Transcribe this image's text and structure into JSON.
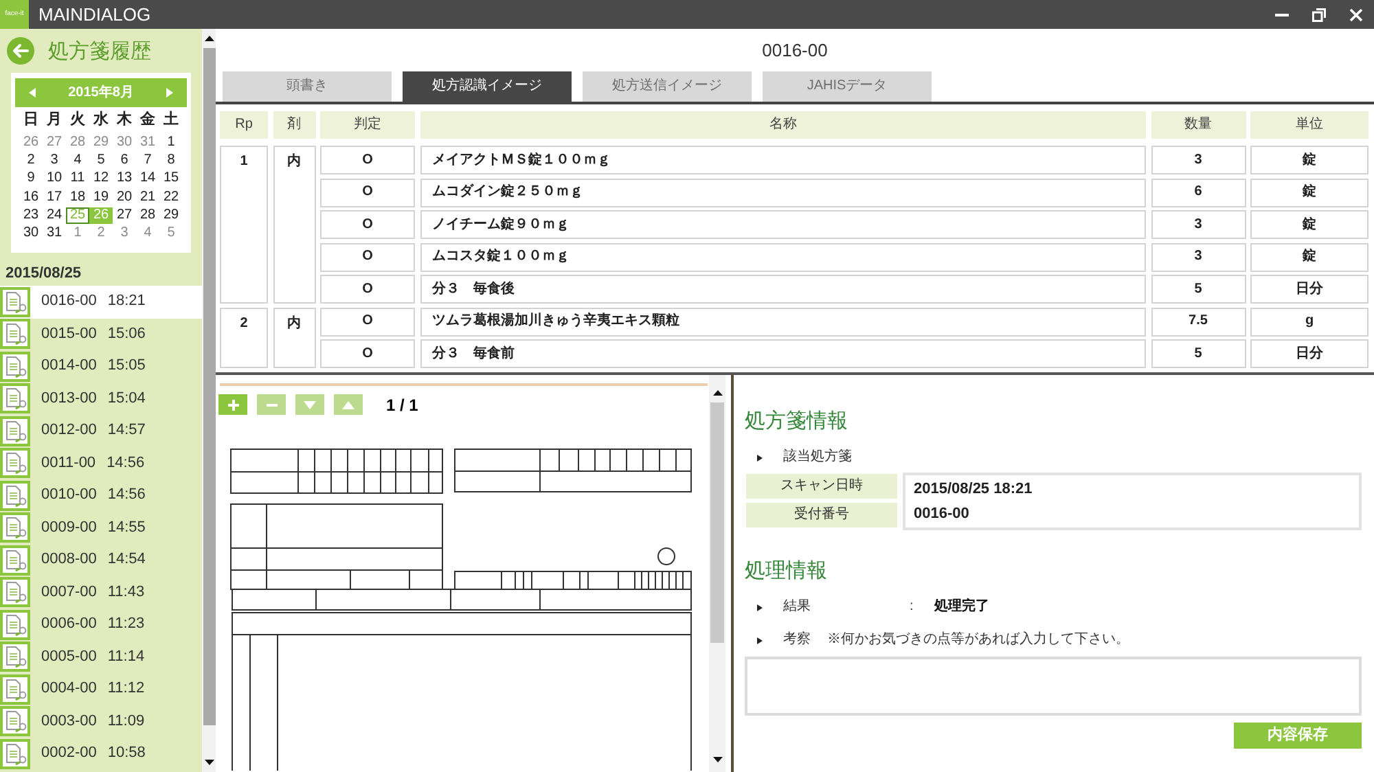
{
  "window": {
    "logo": "face-it",
    "title": "MAINDIALOG"
  },
  "sidebar": {
    "title": "処方箋履歴",
    "calendar": {
      "month": "2015年8月",
      "weekdays": [
        "日",
        "月",
        "火",
        "水",
        "木",
        "金",
        "土"
      ],
      "weeks": [
        [
          {
            "day": "26",
            "muted": true,
            "selected": false,
            "today": false
          },
          {
            "day": "27",
            "muted": true,
            "selected": false,
            "today": false
          },
          {
            "day": "28",
            "muted": true,
            "selected": false,
            "today": false
          },
          {
            "day": "29",
            "muted": true,
            "selected": false,
            "today": false
          },
          {
            "day": "30",
            "muted": true,
            "selected": false,
            "today": false
          },
          {
            "day": "31",
            "muted": true,
            "selected": false,
            "today": false
          },
          {
            "day": "1",
            "muted": false,
            "selected": false,
            "today": false
          }
        ],
        [
          {
            "day": "2",
            "muted": false,
            "selected": false,
            "today": false
          },
          {
            "day": "3",
            "muted": false,
            "selected": false,
            "today": false
          },
          {
            "day": "4",
            "muted": false,
            "selected": false,
            "today": false
          },
          {
            "day": "5",
            "muted": false,
            "selected": false,
            "today": false
          },
          {
            "day": "6",
            "muted": false,
            "selected": false,
            "today": false
          },
          {
            "day": "7",
            "muted": false,
            "selected": false,
            "today": false
          },
          {
            "day": "8",
            "muted": false,
            "selected": false,
            "today": false
          }
        ],
        [
          {
            "day": "9",
            "muted": false,
            "selected": false,
            "today": false
          },
          {
            "day": "10",
            "muted": false,
            "selected": false,
            "today": false
          },
          {
            "day": "11",
            "muted": false,
            "selected": false,
            "today": false
          },
          {
            "day": "12",
            "muted": false,
            "selected": false,
            "today": false
          },
          {
            "day": "13",
            "muted": false,
            "selected": false,
            "today": false
          },
          {
            "day": "14",
            "muted": false,
            "selected": false,
            "today": false
          },
          {
            "day": "15",
            "muted": false,
            "selected": false,
            "today": false
          }
        ],
        [
          {
            "day": "16",
            "muted": false,
            "selected": false,
            "today": false
          },
          {
            "day": "17",
            "muted": false,
            "selected": false,
            "today": false
          },
          {
            "day": "18",
            "muted": false,
            "selected": false,
            "today": false
          },
          {
            "day": "19",
            "muted": false,
            "selected": false,
            "today": false
          },
          {
            "day": "20",
            "muted": false,
            "selected": false,
            "today": false
          },
          {
            "day": "21",
            "muted": false,
            "selected": false,
            "today": false
          },
          {
            "day": "22",
            "muted": false,
            "selected": false,
            "today": false
          }
        ],
        [
          {
            "day": "23",
            "muted": false,
            "selected": false,
            "today": false
          },
          {
            "day": "24",
            "muted": false,
            "selected": false,
            "today": false
          },
          {
            "day": "25",
            "muted": false,
            "selected": true,
            "today": false
          },
          {
            "day": "26",
            "muted": false,
            "selected": false,
            "today": true
          },
          {
            "day": "27",
            "muted": false,
            "selected": false,
            "today": false
          },
          {
            "day": "28",
            "muted": false,
            "selected": false,
            "today": false
          },
          {
            "day": "29",
            "muted": false,
            "selected": false,
            "today": false
          }
        ],
        [
          {
            "day": "30",
            "muted": false,
            "selected": false,
            "today": false
          },
          {
            "day": "31",
            "muted": false,
            "selected": false,
            "today": false
          },
          {
            "day": "1",
            "muted": true,
            "selected": false,
            "today": false
          },
          {
            "day": "2",
            "muted": true,
            "selected": false,
            "today": false
          },
          {
            "day": "3",
            "muted": true,
            "selected": false,
            "today": false
          },
          {
            "day": "4",
            "muted": true,
            "selected": false,
            "today": false
          },
          {
            "day": "5",
            "muted": true,
            "selected": false,
            "today": false
          }
        ]
      ]
    },
    "date": "2015/08/25",
    "items": [
      {
        "number": "0016-00",
        "time": "18:21",
        "selected": true
      },
      {
        "number": "0015-00",
        "time": "15:06",
        "selected": false
      },
      {
        "number": "0014-00",
        "time": "15:05",
        "selected": false
      },
      {
        "number": "0013-00",
        "time": "15:04",
        "selected": false
      },
      {
        "number": "0012-00",
        "time": "14:57",
        "selected": false
      },
      {
        "number": "0011-00",
        "time": "14:56",
        "selected": false
      },
      {
        "number": "0010-00",
        "time": "14:56",
        "selected": false
      },
      {
        "number": "0009-00",
        "time": "14:55",
        "selected": false
      },
      {
        "number": "0008-00",
        "time": "14:54",
        "selected": false
      },
      {
        "number": "0007-00",
        "time": "11:43",
        "selected": false
      },
      {
        "number": "0006-00",
        "time": "11:23",
        "selected": false
      },
      {
        "number": "0005-00",
        "time": "11:14",
        "selected": false
      },
      {
        "number": "0004-00",
        "time": "11:12",
        "selected": false
      },
      {
        "number": "0003-00",
        "time": "11:09",
        "selected": false
      },
      {
        "number": "0002-00",
        "time": "10:58",
        "selected": false
      }
    ]
  },
  "record": {
    "title": "0016-00"
  },
  "tabs": [
    {
      "label": "頭書き",
      "selected": false
    },
    {
      "label": "処方認識イメージ",
      "selected": true
    },
    {
      "label": "処方送信イメージ",
      "selected": false
    },
    {
      "label": "JAHISデータ",
      "selected": false
    }
  ],
  "table": {
    "columns": [
      "Rp",
      "剤",
      "判定",
      "名称",
      "数量",
      "単位"
    ],
    "groups": [
      {
        "rp": "1",
        "form": "内",
        "rows": [
          {
            "judgement": "O",
            "name": "メイアクトＭＳ錠１００ｍｇ",
            "quantity": "3",
            "unit": "錠"
          },
          {
            "judgement": "O",
            "name": "ムコダイン錠２５０ｍｇ",
            "quantity": "6",
            "unit": "錠"
          },
          {
            "judgement": "O",
            "name": "ノイチーム錠９０ｍｇ",
            "quantity": "3",
            "unit": "錠"
          },
          {
            "judgement": "O",
            "name": "ムコスタ錠１００ｍｇ",
            "quantity": "3",
            "unit": "錠"
          },
          {
            "judgement": "O",
            "name": "分３　毎食後",
            "quantity": "5",
            "unit": "日分"
          }
        ]
      },
      {
        "rp": "2",
        "form": "内",
        "rows": [
          {
            "judgement": "O",
            "name": "ツムラ葛根湯加川きゅう辛夷エキス顆粒",
            "quantity": "7.5",
            "unit": "g"
          },
          {
            "judgement": "O",
            "name": "分３　毎食前",
            "quantity": "5",
            "unit": "日分"
          }
        ]
      }
    ]
  },
  "viewer": {
    "tools": [
      {
        "kind": "plus",
        "disabled": false
      },
      {
        "kind": "minus",
        "disabled": true
      },
      {
        "kind": "down",
        "disabled": true
      },
      {
        "kind": "up",
        "disabled": true
      }
    ],
    "page": "1 / 1"
  },
  "prescription_info": {
    "heading": "処方箋情報",
    "subheading": "該当処方箋",
    "fields": [
      {
        "label": "スキャン日時",
        "value": "2015/08/25 18:21"
      },
      {
        "label": "受付番号",
        "value": "0016-00"
      }
    ]
  },
  "processing_info": {
    "heading": "処理情報",
    "result": {
      "label": "結果",
      "separator": ":",
      "value": "処理完了"
    },
    "remarks": {
      "label": "考察",
      "hint": "※何かお気づきの点等があれば入力して下さい。"
    },
    "save_button": "内容保存"
  }
}
